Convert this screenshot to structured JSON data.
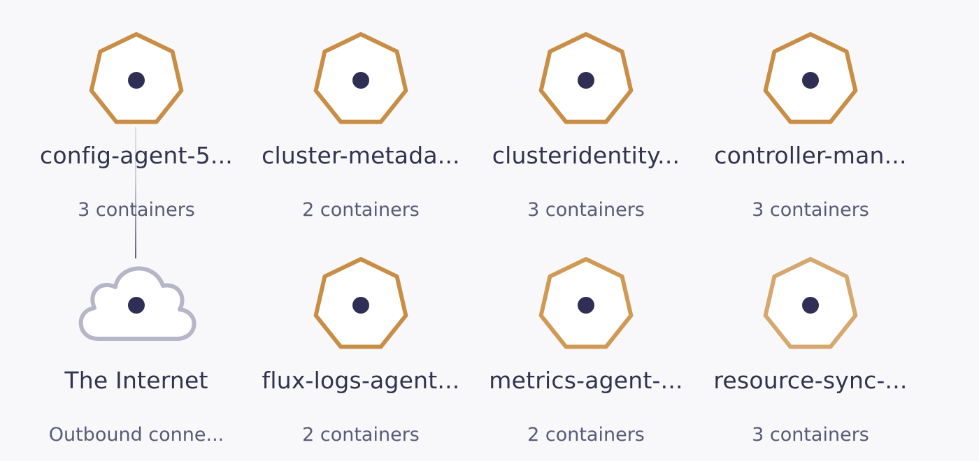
{
  "nodes": [
    {
      "id": "config-agent",
      "label": "config-agent-5...",
      "sublabel": "3 containers",
      "shape": "heptagon",
      "stroke": "#c98e46"
    },
    {
      "id": "cluster-metadata",
      "label": "cluster-metada...",
      "sublabel": "2 containers",
      "shape": "heptagon",
      "stroke": "#c98e46"
    },
    {
      "id": "clusteridentity",
      "label": "clusteridentity...",
      "sublabel": "3 containers",
      "shape": "heptagon",
      "stroke": "#c98e46"
    },
    {
      "id": "controller-manager",
      "label": "controller-man...",
      "sublabel": "3 containers",
      "shape": "heptagon",
      "stroke": "#c98e46"
    },
    {
      "id": "the-internet",
      "label": "The Internet",
      "sublabel": "Outbound conne...",
      "shape": "cloud",
      "stroke": "#b6b6c8"
    },
    {
      "id": "flux-logs-agent",
      "label": "flux-logs-agent...",
      "sublabel": "2 containers",
      "shape": "heptagon",
      "stroke": "#c98e46"
    },
    {
      "id": "metrics-agent",
      "label": "metrics-agent-...",
      "sublabel": "2 containers",
      "shape": "heptagon",
      "stroke": "#d09a55"
    },
    {
      "id": "resource-sync",
      "label": "resource-sync-...",
      "sublabel": "3 containers",
      "shape": "heptagon",
      "stroke": "#d6a86f"
    }
  ],
  "colors": {
    "background": "#f8f8fb",
    "node_fill": "#ffffff",
    "center_dot": "#2f2e55",
    "label": "#33324f",
    "sublabel": "#5a5a78"
  },
  "edges": [
    {
      "from": "config-agent",
      "to": "the-internet"
    }
  ]
}
